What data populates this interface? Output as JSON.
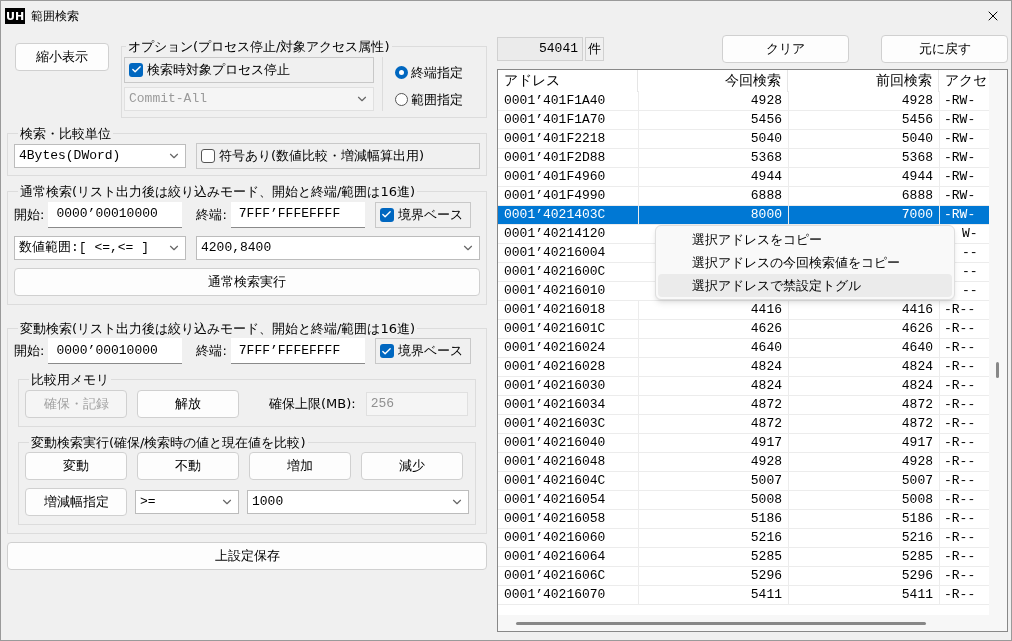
{
  "window": {
    "title": "範囲検索",
    "app_icon": "UH"
  },
  "left": {
    "shrink_button": "縮小表示",
    "options": {
      "legend": "オプション(プロセス停止/対象アクセス属性)",
      "stop_process": {
        "label": "検索時対象プロセス停止",
        "checked": true
      },
      "access_select": {
        "value": "Commit-All",
        "disabled": true
      }
    },
    "end_mode": [
      {
        "label": "終端指定",
        "selected": true
      },
      {
        "label": "範囲指定",
        "selected": false
      }
    ],
    "unit": {
      "legend": "検索・比較単位",
      "select": "4Bytes(DWord)",
      "signed": {
        "label": "符号あり(数値比較・増減幅算出用)",
        "checked": false
      }
    },
    "normal_search": {
      "legend": "通常検索(リスト出力後は絞り込みモード、開始と終端/範囲は16進)",
      "start_label": "開始:",
      "start": "0000’00010000",
      "end_label": "終端:",
      "end": "7FFF’FFFEFFFF",
      "boundary": {
        "label": "境界ベース",
        "checked": true
      },
      "compare": "数値範囲:[ <=,<= ]",
      "value": "4200,8400",
      "run_button": "通常検索実行"
    },
    "change_search": {
      "legend": "変動検索(リスト出力後は絞り込みモード、開始と終端/範囲は16進)",
      "start_label": "開始:",
      "start": "0000’00010000",
      "end_label": "終端:",
      "end": "7FFF’FFFEFFFF",
      "boundary": {
        "label": "境界ベース",
        "checked": true
      },
      "memory": {
        "legend": "比較用メモリ",
        "buttons": [
          {
            "label": "確保・記録",
            "disabled": true
          },
          {
            "label": "解放",
            "disabled": false
          }
        ],
        "limit_label": "確保上限(MB):",
        "limit": "256"
      },
      "exec": {
        "legend": "変動検索実行(確保/検索時の値と現在値を比較)",
        "buttons": [
          "変動",
          "不動",
          "増加",
          "減少"
        ],
        "delta_button": "増減幅指定",
        "operator": ">=",
        "delta": "1000"
      }
    },
    "save_button": "上設定保存"
  },
  "right": {
    "count": "54041",
    "count_unit": "件",
    "clear_button": "クリア",
    "undo_button": "元に戻す",
    "table": {
      "columns": [
        "アドレス",
        "今回検索",
        "前回検索",
        "アクセ"
      ],
      "rows": [
        {
          "address": "0001’401F1A40",
          "current": "4928",
          "previous": "4928",
          "access": "-RW-",
          "selected": false
        },
        {
          "address": "0001’401F1A70",
          "current": "5456",
          "previous": "5456",
          "access": "-RW-",
          "selected": false
        },
        {
          "address": "0001’401F2218",
          "current": "5040",
          "previous": "5040",
          "access": "-RW-",
          "selected": false
        },
        {
          "address": "0001’401F2D88",
          "current": "5368",
          "previous": "5368",
          "access": "-RW-",
          "selected": false
        },
        {
          "address": "0001’401F4960",
          "current": "4944",
          "previous": "4944",
          "access": "-RW-",
          "selected": false
        },
        {
          "address": "0001’401F4990",
          "current": "6888",
          "previous": "6888",
          "access": "-RW-",
          "selected": false
        },
        {
          "address": "0001’4021403C",
          "current": "8000",
          "previous": "7000",
          "access": "-RW-",
          "selected": true
        },
        {
          "address": "0001’40214120",
          "access": "W-",
          "selected": false
        },
        {
          "address": "0001’40216004",
          "access": "--",
          "selected": false
        },
        {
          "address": "0001’4021600C",
          "access": "--",
          "selected": false
        },
        {
          "address": "0001’40216010",
          "access": "--",
          "selected": false
        },
        {
          "address": "0001’40216018",
          "current": "4416",
          "previous": "4416",
          "access": "-R--",
          "selected": false
        },
        {
          "address": "0001’4021601C",
          "current": "4626",
          "previous": "4626",
          "access": "-R--",
          "selected": false
        },
        {
          "address": "0001’40216024",
          "current": "4640",
          "previous": "4640",
          "access": "-R--",
          "selected": false
        },
        {
          "address": "0001’40216028",
          "current": "4824",
          "previous": "4824",
          "access": "-R--",
          "selected": false
        },
        {
          "address": "0001’40216030",
          "current": "4824",
          "previous": "4824",
          "access": "-R--",
          "selected": false
        },
        {
          "address": "0001’40216034",
          "current": "4872",
          "previous": "4872",
          "access": "-R--",
          "selected": false
        },
        {
          "address": "0001’4021603C",
          "current": "4872",
          "previous": "4872",
          "access": "-R--",
          "selected": false
        },
        {
          "address": "0001’40216040",
          "current": "4917",
          "previous": "4917",
          "access": "-R--",
          "selected": false
        },
        {
          "address": "0001’40216048",
          "current": "4928",
          "previous": "4928",
          "access": "-R--",
          "selected": false
        },
        {
          "address": "0001’4021604C",
          "current": "5007",
          "previous": "5007",
          "access": "-R--",
          "selected": false
        },
        {
          "address": "0001’40216054",
          "current": "5008",
          "previous": "5008",
          "access": "-R--",
          "selected": false
        },
        {
          "address": "0001’40216058",
          "current": "5186",
          "previous": "5186",
          "access": "-R--",
          "selected": false
        },
        {
          "address": "0001’40216060",
          "current": "5216",
          "previous": "5216",
          "access": "-R--",
          "selected": false
        },
        {
          "address": "0001’40216064",
          "current": "5285",
          "previous": "5285",
          "access": "-R--",
          "selected": false
        },
        {
          "address": "0001’4021606C",
          "current": "5296",
          "previous": "5296",
          "access": "-R--",
          "selected": false
        },
        {
          "address": "0001’40216070",
          "current": "5411",
          "previous": "5411",
          "access": "-R--",
          "selected": false
        }
      ]
    },
    "context_menu": [
      {
        "label": "選択アドレスをコピー",
        "selected": false
      },
      {
        "label": "選択アドレスの今回検索値をコピー",
        "selected": false
      },
      {
        "label": "選択アドレスで禁設定トグル",
        "selected": true
      }
    ]
  }
}
